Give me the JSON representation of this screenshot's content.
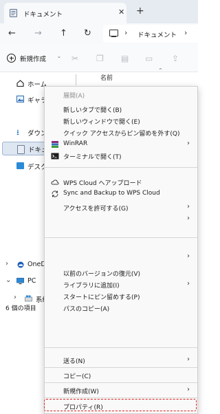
{
  "tab": {
    "title": "ドキュメント",
    "close_glyph": "✕",
    "new_tab_glyph": "+"
  },
  "nav": {
    "back_glyph": "←",
    "forward_glyph": "→",
    "up_glyph": "↑",
    "refresh_glyph": "↻",
    "address_crumb": "ドキュメント",
    "chevron": "›"
  },
  "toolbar": {
    "new_label": "新規作成",
    "new_chevron": "⌄"
  },
  "sidebar": {
    "items": [
      {
        "label": "ホーム",
        "icon": "home-icon"
      },
      {
        "label": "ギャラ",
        "icon": "gallery-icon"
      },
      {
        "label": "ダウンロ",
        "icon": "download-icon"
      },
      {
        "label": "ドキュメ",
        "icon": "documents-icon"
      },
      {
        "label": "デスク",
        "icon": "desktop-icon"
      },
      {
        "label": "OneD",
        "icon": "onedrive-icon"
      },
      {
        "label": "PC",
        "icon": "pc-icon"
      },
      {
        "label": "系统",
        "icon": "drive-icon"
      }
    ]
  },
  "content": {
    "column_name": "名前",
    "sort_glyph": "⌃"
  },
  "status": {
    "item_count": "6 個の項目"
  },
  "context_menu": {
    "items": [
      {
        "label": "展開(A)",
        "disabled": true
      },
      {
        "label": "新しいタブで開く(B)"
      },
      {
        "label": "新しいウィンドウで開く(E)"
      },
      {
        "label": "クイック アクセスからピン留めを外す(Q)"
      },
      {
        "label": "WinRAR",
        "icon": "winrar-icon",
        "submenu": true
      },
      {
        "label": "ターミナルで開く(T)",
        "icon": "terminal-icon"
      },
      {
        "label": "WPS Cloud へアップロード",
        "icon": "cloud-icon"
      },
      {
        "label": "Sync and Backup to WPS Cloud",
        "icon": "sync-icon"
      },
      {
        "label": "アクセスを許可する(G)",
        "submenu": true
      },
      {
        "label": "",
        "submenu": true
      },
      {
        "label": "",
        "submenu": true
      },
      {
        "label": "以前のバージョンの復元(V)"
      },
      {
        "label": "ライブラリに追加(I)",
        "submenu": true
      },
      {
        "label": "スタートにピン留めする(P)"
      },
      {
        "label": "パスのコピー(A)"
      },
      {
        "label": "送る(N)",
        "submenu": true
      },
      {
        "label": "コピー(C)"
      },
      {
        "label": "新規作成(W)",
        "submenu": true
      },
      {
        "label": "プロパティ(R)",
        "highlighted": true
      }
    ],
    "submenu_glyph": "›",
    "highlight_color": "#e02020"
  },
  "colors": {
    "tabstrip": "#e6ebf1",
    "selection": "#dde6f1",
    "accent": "#1f6fc2"
  }
}
